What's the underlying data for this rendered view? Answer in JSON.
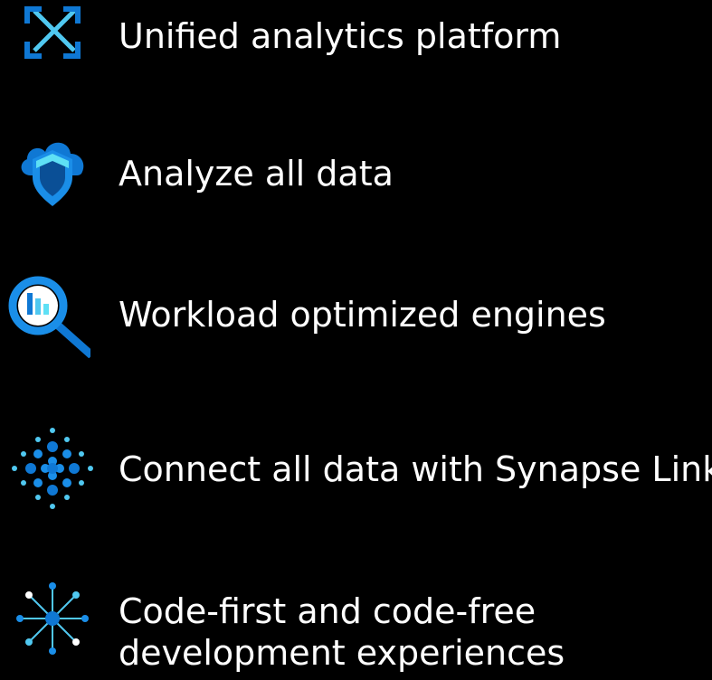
{
  "features": [
    {
      "label": "Unified analytics platform",
      "icon": "expand-arrows-icon"
    },
    {
      "label": "Analyze all data",
      "icon": "cloud-shield-icon"
    },
    {
      "label": "Workload optimized engines",
      "icon": "magnifier-chart-icon"
    },
    {
      "label": "Connect all data with Synapse Link",
      "icon": "dot-grid-icon"
    },
    {
      "label_lines": [
        "Code-first and code-free",
        "development experiences"
      ],
      "icon": "hub-spokes-icon"
    }
  ],
  "colors": {
    "background": "#000000",
    "text": "#ffffff",
    "icon_blue": "#0f78d4",
    "icon_light_blue": "#50c8f0",
    "icon_cyan": "#5ee0f5"
  }
}
